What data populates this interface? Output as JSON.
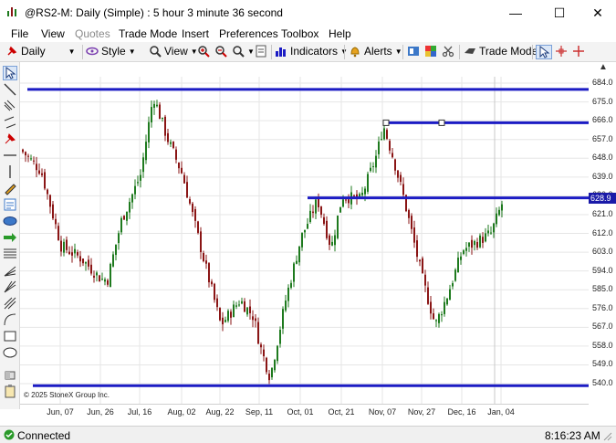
{
  "window": {
    "title": "@RS2-M: Daily (Simple) : 5 hour 3 minute 36 second",
    "minimize": "—",
    "maximize": "☐",
    "close": "✕"
  },
  "menu": [
    "File",
    "View",
    "Quotes",
    "Trade Mode",
    "Insert",
    "Preferences",
    "Toolbox",
    "Help"
  ],
  "toolbar": {
    "interval": "Daily",
    "style": "Style",
    "view": "View",
    "indicators": "Indicators",
    "alerts": "Alerts",
    "trade_mode": "Trade Mode"
  },
  "chart": {
    "copyright": "© 2025 StoneX Group Inc.",
    "last_price": "628.9",
    "y_ticks": [
      "684.0",
      "675.0",
      "666.0",
      "657.0",
      "648.0",
      "639.0",
      "630.0",
      "621.0",
      "612.0",
      "603.0",
      "594.0",
      "585.0",
      "576.0",
      "567.0",
      "558.0",
      "549.0",
      "540.0"
    ],
    "x_ticks": [
      "Jun, 07",
      "Jun, 26",
      "Jul, 16",
      "Aug, 02",
      "Aug, 22",
      "Sep, 11",
      "Oct, 01",
      "Oct, 21",
      "Nov, 07",
      "Nov, 27",
      "Dec, 16",
      "Jan, 04"
    ],
    "colors": {
      "up": "#1e7a1e",
      "down": "#8a1515",
      "line": "#1c1cc4",
      "price_tag": "#1a1aa8"
    }
  },
  "status": {
    "connection": "Connected",
    "time": "8:16:23 AM"
  }
}
